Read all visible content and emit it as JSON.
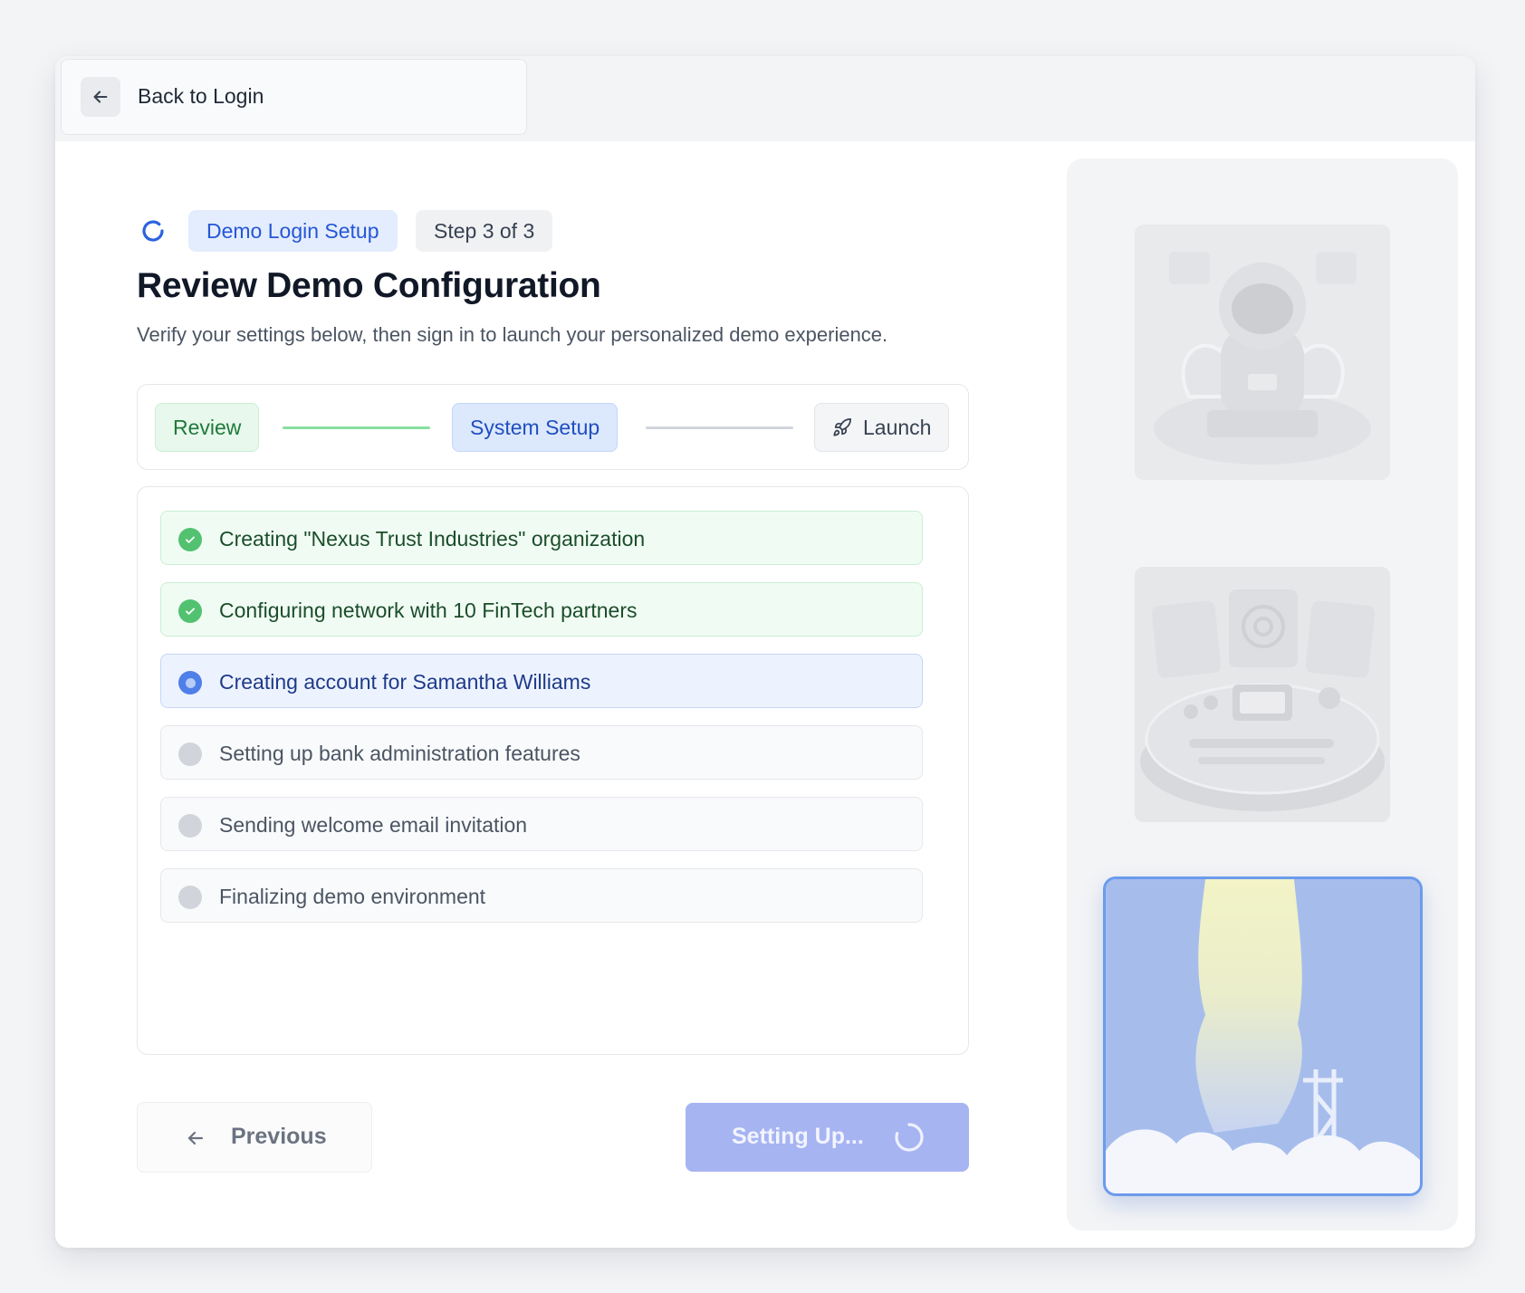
{
  "header": {
    "back_label": "Back to Login"
  },
  "intro": {
    "badge": "Demo Login Setup",
    "step_indicator": "Step 3 of 3",
    "title": "Review Demo Configuration",
    "subtitle": "Verify your settings below, then sign in to launch your personalized demo experience."
  },
  "stepper": {
    "steps": [
      {
        "label": "Review",
        "state": "complete"
      },
      {
        "label": "System Setup",
        "state": "current"
      },
      {
        "label": "Launch",
        "state": "upcoming",
        "icon": "rocket-icon"
      }
    ]
  },
  "tasks": [
    {
      "label": "Creating \"Nexus Trust Industries\" organization",
      "status": "done"
    },
    {
      "label": "Configuring network with 10 FinTech partners",
      "status": "done"
    },
    {
      "label": "Creating account for Samantha Williams",
      "status": "active"
    },
    {
      "label": "Setting up bank administration features",
      "status": "pending"
    },
    {
      "label": "Sending welcome email invitation",
      "status": "pending"
    },
    {
      "label": "Finalizing demo environment",
      "status": "pending"
    }
  ],
  "actions": {
    "previous_label": "Previous",
    "submit_label": "Setting Up..."
  },
  "illustrations": [
    {
      "icon": "astronaut-illustration",
      "state": "inactive"
    },
    {
      "icon": "control-panel-illustration",
      "state": "inactive"
    },
    {
      "icon": "rocket-launch-illustration",
      "state": "active"
    }
  ],
  "colors": {
    "accent_blue": "#2557d6",
    "success_green": "#52c270",
    "button_disabled": "#a7b4f2"
  }
}
